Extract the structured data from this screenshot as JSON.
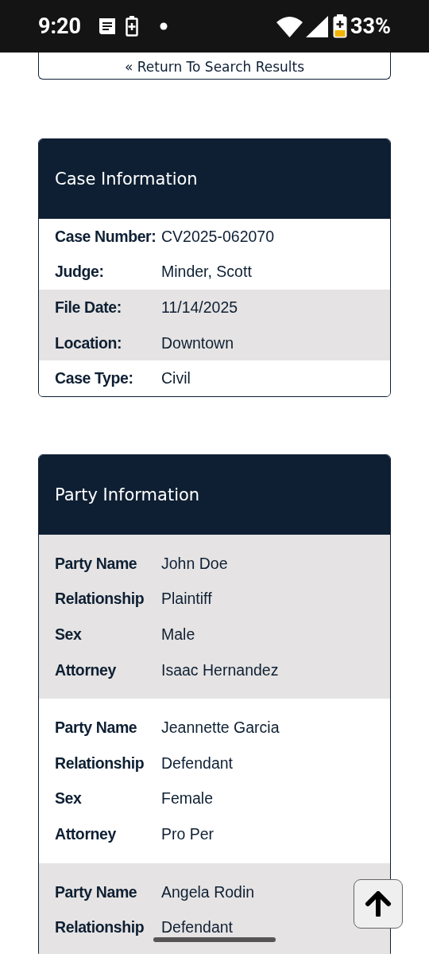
{
  "status_bar": {
    "time": "9:20",
    "battery": "33%"
  },
  "return_link": "« Return To Search Results",
  "case_information": {
    "title": "Case Information",
    "rows": [
      {
        "label": "Case Number:",
        "value": "CV2025-062070",
        "shaded": false
      },
      {
        "label": "Judge:",
        "value": "Minder, Scott",
        "shaded": false
      },
      {
        "label": "File Date:",
        "value": "11/14/2025",
        "shaded": true
      },
      {
        "label": "Location:",
        "value": "Downtown",
        "shaded": true
      },
      {
        "label": "Case Type:",
        "value": "Civil",
        "shaded": false
      }
    ]
  },
  "party_information": {
    "title": "Party Information",
    "parties": [
      {
        "shaded": true,
        "fields": [
          {
            "label": "Party Name",
            "value": "John Doe"
          },
          {
            "label": "Relationship",
            "value": "Plaintiff"
          },
          {
            "label": "Sex",
            "value": "Male"
          },
          {
            "label": "Attorney",
            "value": "Isaac Hernandez"
          }
        ]
      },
      {
        "shaded": false,
        "fields": [
          {
            "label": "Party Name",
            "value": "Jeannette Garcia"
          },
          {
            "label": "Relationship",
            "value": "Defendant"
          },
          {
            "label": "Sex",
            "value": "Female"
          },
          {
            "label": "Attorney",
            "value": "Pro Per"
          }
        ]
      },
      {
        "shaded": true,
        "fields": [
          {
            "label": "Party Name",
            "value": "Angela Rodin"
          },
          {
            "label": "Relationship",
            "value": "Defendant"
          }
        ]
      }
    ]
  }
}
